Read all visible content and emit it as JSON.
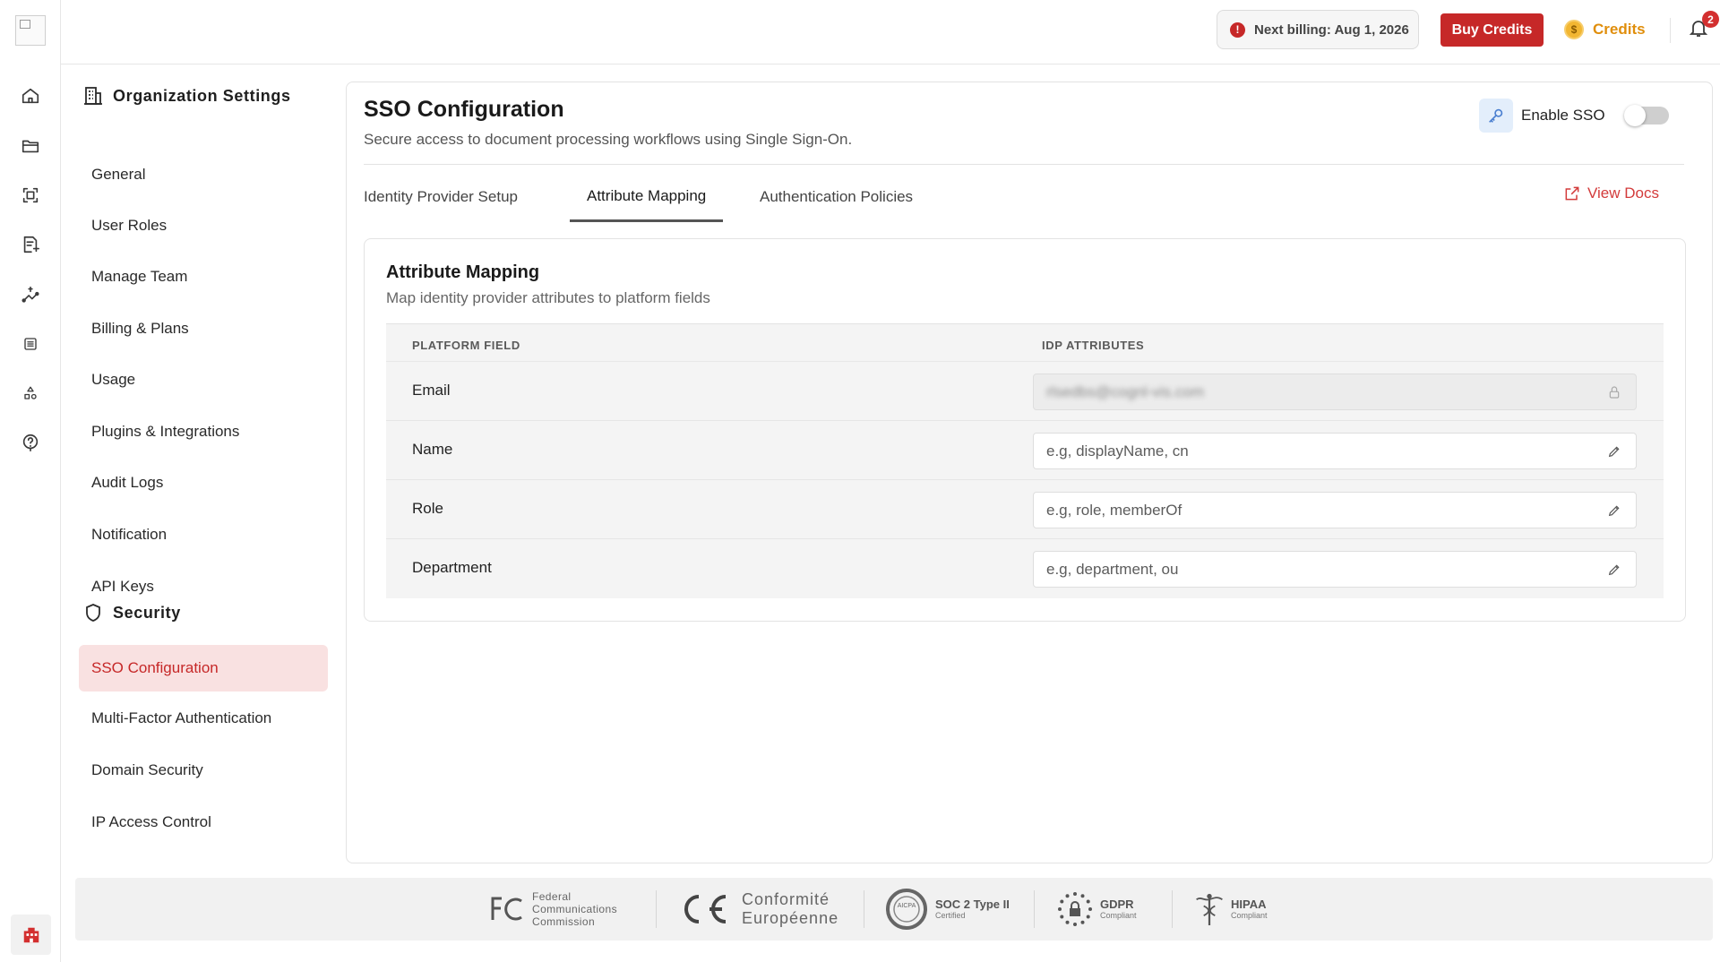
{
  "topbar": {
    "billing_text": "Next billing: Aug 1, 2026",
    "billing_icon": "info-icon",
    "buy_credits_label": "Buy Credits",
    "credits_label": "Credits",
    "coin_symbol": "$",
    "notification_count": "2",
    "accent_color": "#c62828"
  },
  "rail": {
    "icons": [
      "home-icon",
      "folder-icon",
      "scan-icon",
      "document-edit-icon",
      "workflow-icon",
      "grid-list-icon",
      "shapes-icon",
      "help-icon"
    ],
    "bottom_icon": "building-icon"
  },
  "sidebar": {
    "org_heading": "Organization Settings",
    "org_items": [
      {
        "label": "General"
      },
      {
        "label": "User Roles"
      },
      {
        "label": "Manage Team"
      },
      {
        "label": "Billing & Plans"
      },
      {
        "label": "Usage"
      },
      {
        "label": "Plugins & Integrations"
      },
      {
        "label": "Audit Logs"
      },
      {
        "label": "Notification"
      },
      {
        "label": "API Keys"
      }
    ],
    "security_heading": "Security",
    "security_items": [
      {
        "label": "SSO Configuration",
        "active": true
      },
      {
        "label": "Multi-Factor Authentication"
      },
      {
        "label": "Domain Security"
      },
      {
        "label": "IP Access Control"
      }
    ]
  },
  "main": {
    "title": "SSO Configuration",
    "subtitle": "Secure access to document processing workflows using Single Sign-On.",
    "enable_sso_label": "Enable SSO",
    "enable_sso_on": false,
    "tabs": [
      {
        "label": "Identity Provider Setup"
      },
      {
        "label": "Attribute Mapping",
        "active": true
      },
      {
        "label": "Authentication Policies"
      }
    ],
    "view_docs_label": "View Docs"
  },
  "mapping": {
    "title": "Attribute Mapping",
    "subtitle": "Map identity provider attributes to platform fields",
    "col_platform": "PLATFORM FIELD",
    "col_idp": "IDP ATTRIBUTES",
    "rows": [
      {
        "field": "Email",
        "value": "rlsedbs@cognl-vis.com",
        "placeholder": "",
        "locked": true
      },
      {
        "field": "Name",
        "value": "",
        "placeholder": "e.g, displayName, cn",
        "locked": false
      },
      {
        "field": "Role",
        "value": "",
        "placeholder": "e.g, role, memberOf",
        "locked": false
      },
      {
        "field": "Department",
        "value": "",
        "placeholder": "e.g, department, ou",
        "locked": false
      }
    ]
  },
  "footer": {
    "fcc": [
      "Federal",
      "Communications",
      "Commission"
    ],
    "ce": [
      "Conformité",
      "Européenne"
    ],
    "soc_main": "SOC 2 Type II",
    "soc_sub": "Certified",
    "soc_seal": "AICPA",
    "gdpr_main": "GDPR",
    "gdpr_sub": "Compliant",
    "hipaa_main": "HIPAA",
    "hipaa_sub": "Compliant"
  }
}
